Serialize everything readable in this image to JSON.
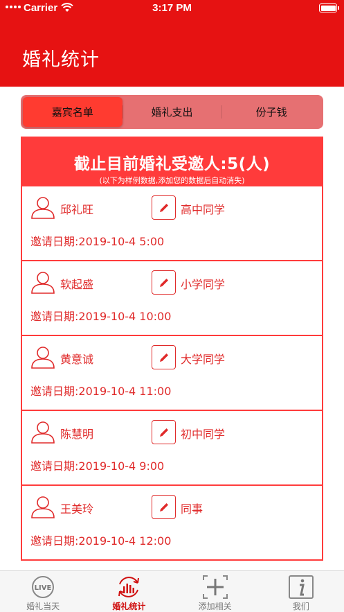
{
  "status_bar": {
    "carrier": "Carrier",
    "time": "3:17 PM"
  },
  "header": {
    "title": "婚礼统计"
  },
  "segments": [
    {
      "label": "嘉宾名单",
      "selected": true
    },
    {
      "label": "婚礼支出",
      "selected": false
    },
    {
      "label": "份子钱",
      "selected": false
    }
  ],
  "summary": {
    "title": "截止目前婚礼受邀人:5(人)",
    "note": "(以下为样例数据,添加您的数据后自动消失)"
  },
  "date_label": "邀请日期:",
  "guests": [
    {
      "name": "邱礼旺",
      "relation": "高中同学",
      "date": "2019-10-4 5:00"
    },
    {
      "name": "软起盛",
      "relation": "小学同学",
      "date": "2019-10-4 10:00"
    },
    {
      "name": "黄意诚",
      "relation": "大学同学",
      "date": "2019-10-4 11:00"
    },
    {
      "name": "陈慧明",
      "relation": "初中同学",
      "date": "2019-10-4 9:00"
    },
    {
      "name": "王美玲",
      "relation": "同事",
      "date": "2019-10-4 12:00"
    }
  ],
  "tabs": [
    {
      "label": "婚礼当天",
      "icon": "live-icon"
    },
    {
      "label": "婚礼统计",
      "icon": "stats-icon",
      "active": true
    },
    {
      "label": "添加相关",
      "icon": "add-icon"
    },
    {
      "label": "我们",
      "icon": "info-icon"
    }
  ],
  "colors": {
    "header": "#e61212",
    "accent": "#ff3b3b",
    "text": "#e02a2a",
    "segment_bg": "#e67072"
  }
}
